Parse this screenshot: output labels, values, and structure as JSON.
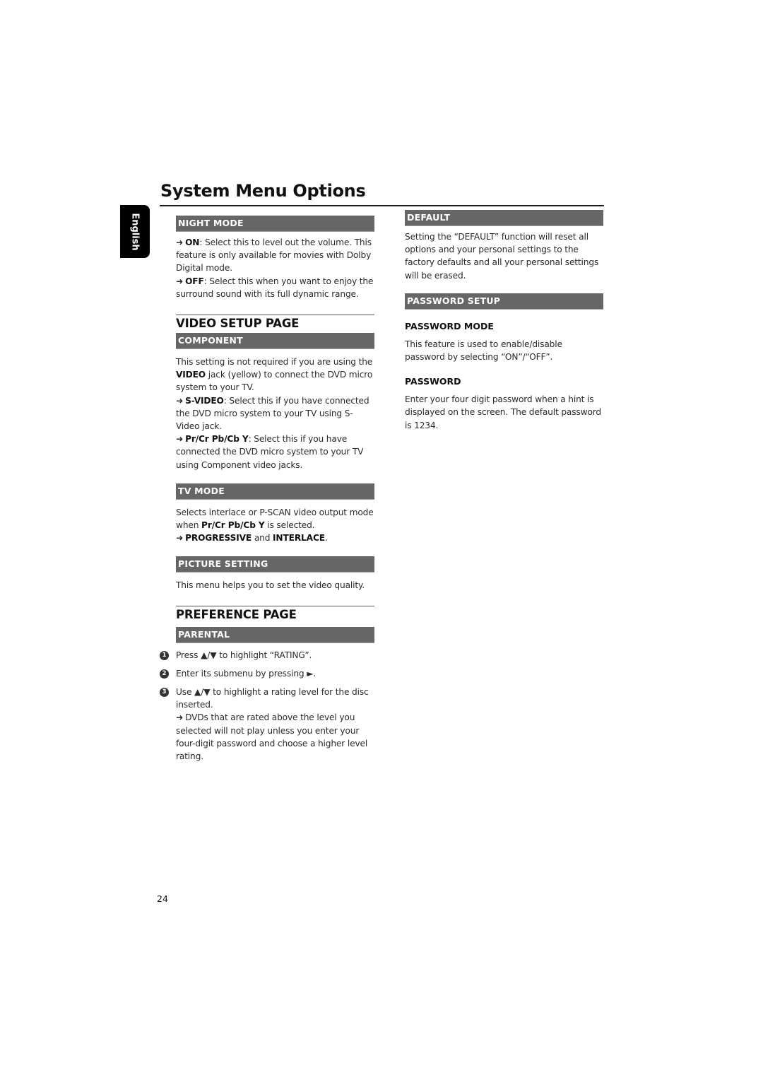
{
  "page": {
    "title": "System Menu Options",
    "language_tab": "English",
    "page_number": "24"
  },
  "left": {
    "night_mode": {
      "header": "NIGHT MODE",
      "on_label": "ON",
      "on_text": ": Select this to level out the volume. This feature is only available for movies with Dolby Digital mode.",
      "off_label": "OFF",
      "off_text": ": Select this when you want to enjoy the surround sound with its full dynamic range."
    },
    "video_setup": {
      "title": "VIDEO SETUP PAGE",
      "component": {
        "header": "COMPONENT",
        "intro_pre": "This setting is not required if you are using the ",
        "intro_bold": "VIDEO",
        "intro_post": " jack (yellow) to connect the DVD micro system to your TV.",
        "svideo_label": "S-VIDEO",
        "svideo_text": ": Select this if you have connected the DVD micro system to your TV using S-Video jack.",
        "ypbpr_label": "Pr/Cr Pb/Cb Y",
        "ypbpr_text": ": Select this if you have connected the DVD micro system to your TV using Component video jacks."
      },
      "tv_mode": {
        "header": "TV MODE",
        "text_pre": "Selects interlace or P-SCAN video output mode when ",
        "text_bold": "Pr/Cr Pb/Cb Y",
        "text_post": " is selected.",
        "opt1": "PROGRESSIVE",
        "and": " and ",
        "opt2": "INTERLACE",
        "end": "."
      },
      "picture_setting": {
        "header": "PICTURE SETTING",
        "text": "This menu helps you to set the video quality."
      }
    },
    "preference": {
      "title": "PREFERENCE PAGE",
      "parental": {
        "header": "PARENTAL",
        "steps": [
          {
            "num": "1",
            "pre": "Press ",
            "keys": "▲/▼",
            "post": "  to highlight “RATING”."
          },
          {
            "num": "2",
            "pre": "Enter its submenu by pressing ",
            "keys": "►",
            "post": "."
          },
          {
            "num": "3",
            "pre": "Use ",
            "keys": "▲/▼",
            "post": "  to highlight a rating level for the disc inserted."
          }
        ],
        "note": "DVDs that are rated above the level you selected will not play unless you enter your four-digit password and choose a higher level rating."
      }
    }
  },
  "right": {
    "default": {
      "header": "DEFAULT",
      "text": "Setting the “DEFAULT” function will reset all options and your personal settings to the factory defaults and all your personal settings will be erased."
    },
    "password_setup": {
      "header": "PASSWORD SETUP",
      "password_mode": {
        "title": "PASSWORD MODE",
        "text": "This feature is used to enable/disable password by selecting “ON”/“OFF”."
      },
      "password": {
        "title": "PASSWORD",
        "text": "Enter your four digit password when a hint is displayed on the screen. The default password is 1234."
      }
    }
  },
  "glyphs": {
    "arrow": "➜"
  }
}
